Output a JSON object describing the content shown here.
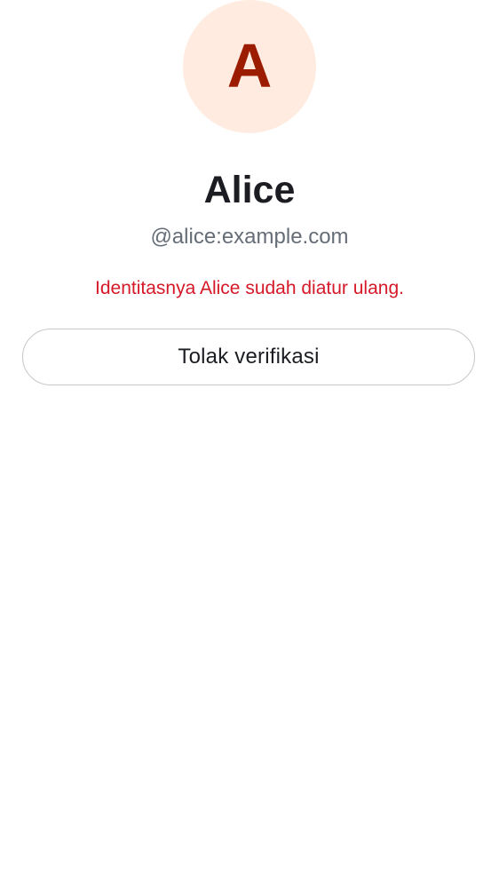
{
  "profile": {
    "avatar_letter": "A",
    "display_name": "Alice",
    "user_id": "@alice:example.com"
  },
  "warning": {
    "message": "Identitasnya Alice sudah diatur ulang."
  },
  "actions": {
    "decline_label": "Tolak verifikasi"
  },
  "colors": {
    "avatar_background": "#ffebe0",
    "avatar_letter": "#9b1c00",
    "warning_text": "#d51928"
  }
}
